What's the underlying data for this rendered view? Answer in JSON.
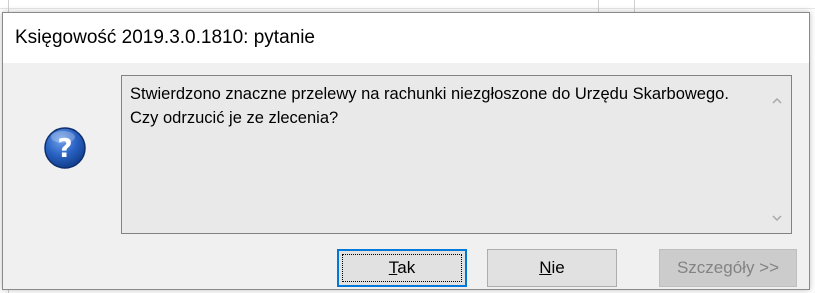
{
  "window": {
    "title": "Księgowość 2019.3.0.1810: pytanie"
  },
  "message": {
    "text": "Stwierdzono znaczne przelewy na rachunki niezgłoszone do Urzędu Skarbowego. Czy odrzucić je ze zlecenia?",
    "icon": "question-icon"
  },
  "buttons": {
    "yes_accel": "T",
    "yes_rest": "ak",
    "no_accel": "N",
    "no_rest": "ie",
    "details_label": "Szczegóły >>"
  },
  "colors": {
    "dialog_bg": "#f0f0f0",
    "icon_blue": "#1f5fbf",
    "focus_border": "#0078d7"
  }
}
